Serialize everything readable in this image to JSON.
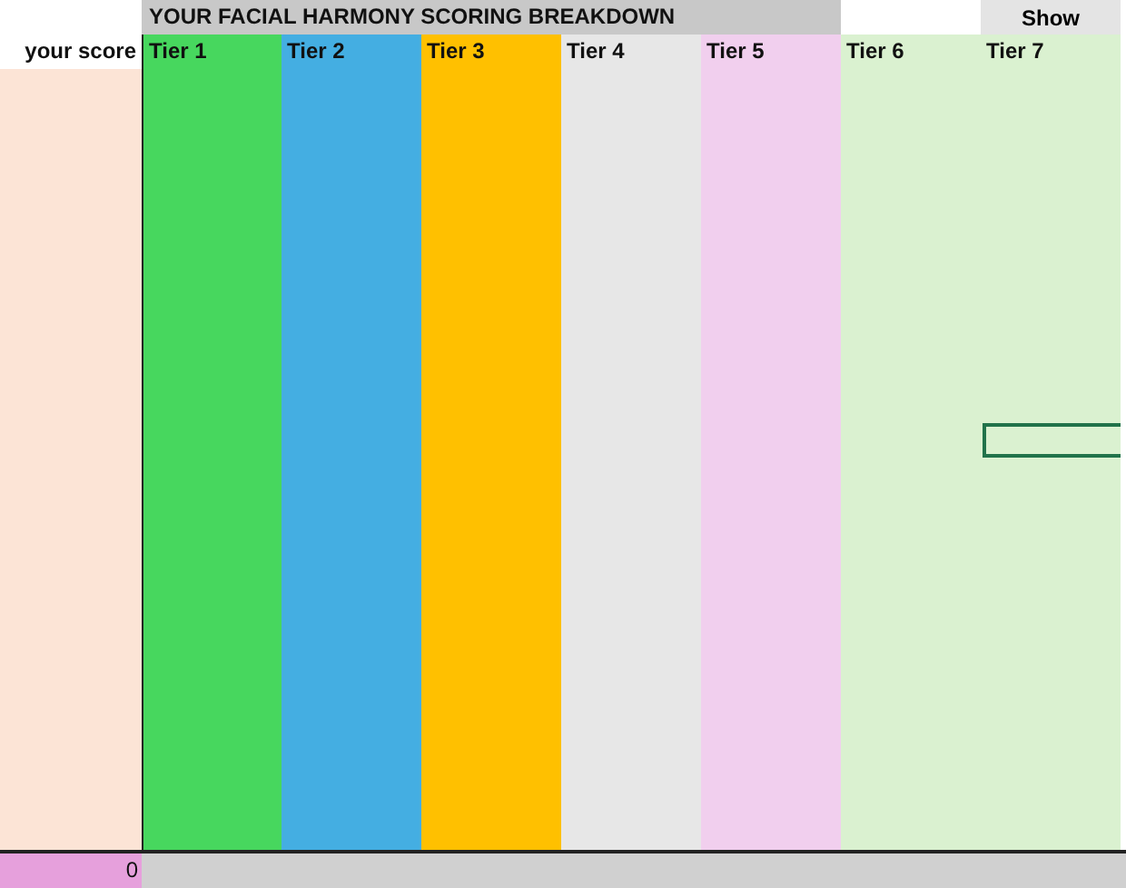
{
  "title": "YOUR FACIAL HARMONY SCORING BREAKDOWN",
  "show_button": "Show",
  "score_label": "your score",
  "tiers": [
    {
      "label": "Tier 1",
      "color": "#47d75e"
    },
    {
      "label": "Tier 2",
      "color": "#44aee2"
    },
    {
      "label": "Tier 3",
      "color": "#ffc000"
    },
    {
      "label": "Tier 4",
      "color": "#e7e7e7"
    },
    {
      "label": "Tier 5",
      "color": "#f1cfee"
    },
    {
      "label": "Tier 6",
      "color": "#daf1d0"
    },
    {
      "label": "Tier 7",
      "color": "#daf1d0"
    }
  ],
  "score_value": "0"
}
